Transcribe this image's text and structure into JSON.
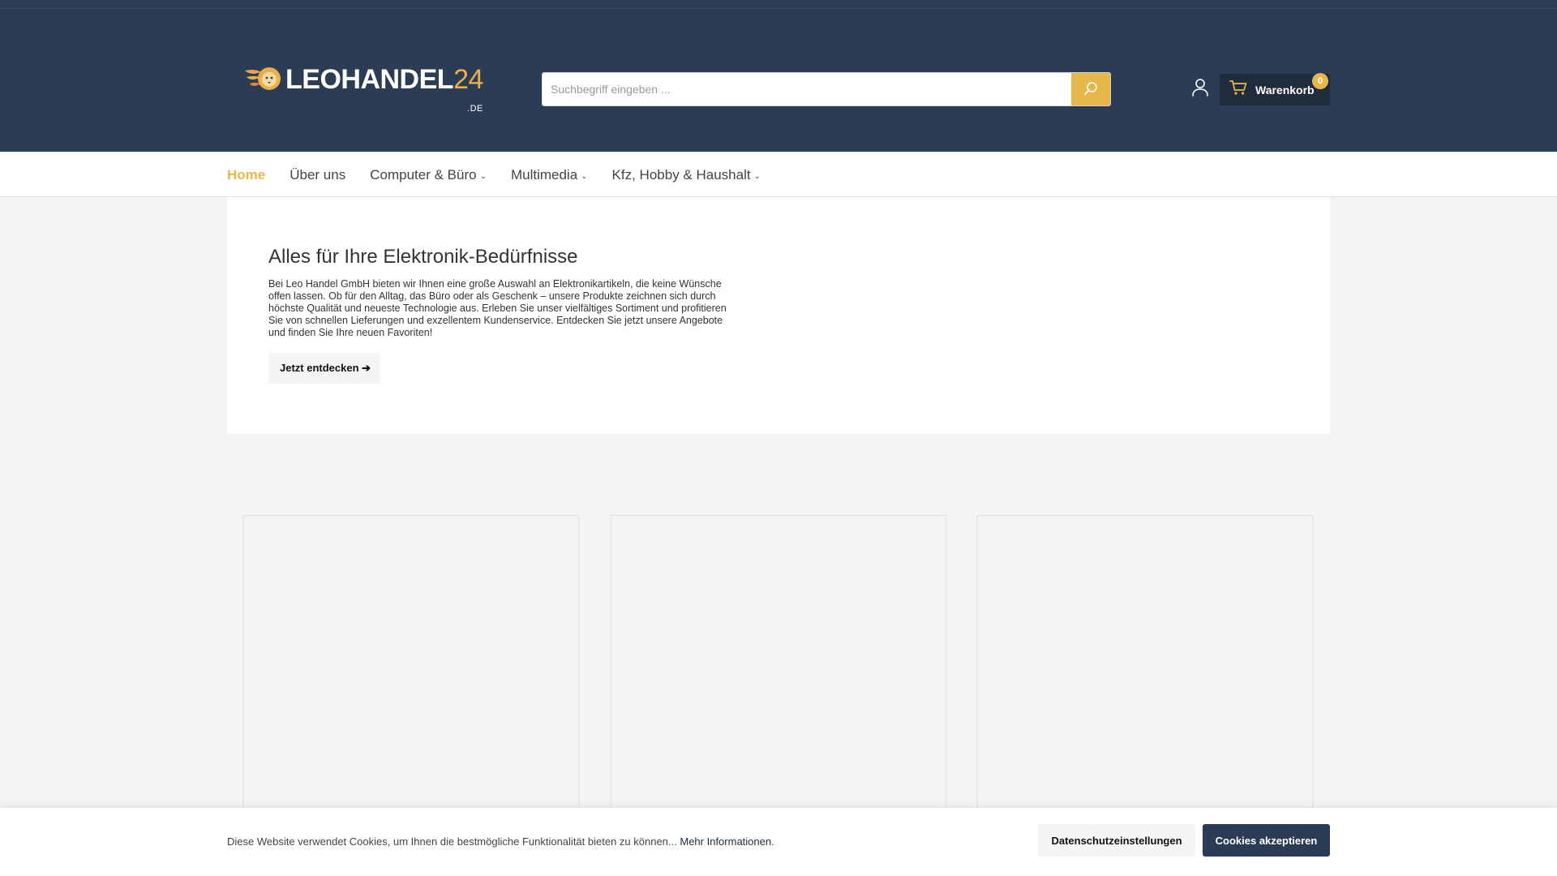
{
  "header": {
    "logo": {
      "text_main": "LEOHANDEL",
      "text_accent": "24",
      "text_sub": ".DE",
      "icon": "lion-head-icon"
    },
    "search": {
      "placeholder": "Suchbegriff eingeben ...",
      "value": "",
      "button_icon": "search-icon"
    },
    "account_icon": "user-icon",
    "cart": {
      "label": "Warenkorb",
      "count": "0",
      "icon": "cart-icon"
    }
  },
  "nav": {
    "items": [
      {
        "label": "Home",
        "active": true,
        "dropdown": false
      },
      {
        "label": "Über uns",
        "active": false,
        "dropdown": false
      },
      {
        "label": "Computer & Büro",
        "active": false,
        "dropdown": true
      },
      {
        "label": "Multimedia",
        "active": false,
        "dropdown": true
      },
      {
        "label": "Kfz, Hobby & Haushalt",
        "active": false,
        "dropdown": true
      }
    ]
  },
  "hero": {
    "title": "Alles für Ihre Elektronik-Bedürfnisse",
    "text": "Bei Leo Handel GmbH bieten wir Ihnen eine große Auswahl an Elektronikartikeln, die keine Wünsche offen lassen. Ob für den Alltag, das Büro oder als Geschenk – unsere Produkte zeichnen sich durch höchste Qualität und neueste Technologie aus. Erleben Sie unser vielfältiges Sortiment und profitieren Sie von schnellen Lieferungen und exzellentem Kundenservice. Entdecken Sie jetzt unsere Angebote und finden Sie Ihre neuen Favoriten!",
    "button_label": "Jetzt entdecken ➔"
  },
  "cookie": {
    "text": "Diese Website verwendet Cookies, um Ihnen die bestmögliche Funktionalität bieten zu können...",
    "link": "Mehr Informationen",
    "link_suffix": ".",
    "settings_label": "Datenschutzeinstellungen",
    "accept_label": "Cookies akzeptieren"
  },
  "colors": {
    "header_bg": "#2c3c54",
    "accent": "#e6b74a",
    "cart_bg": "#1f2c3d",
    "page_bg": "#f4f4f4"
  }
}
